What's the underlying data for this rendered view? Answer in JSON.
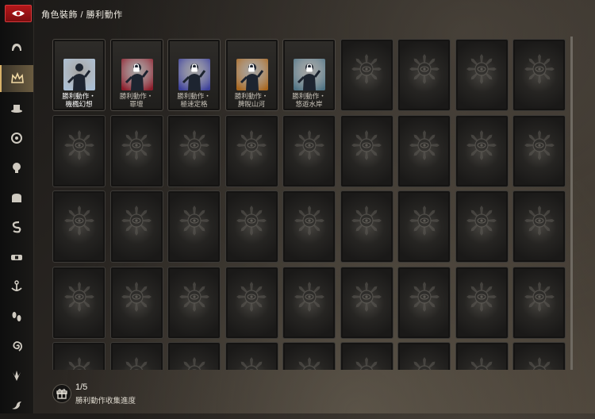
{
  "breadcrumb": "角色裝飾 / 勝利動作",
  "sidebar": {
    "back_icon": "eye-back-icon",
    "items": [
      {
        "icon": "hair-icon",
        "active": false
      },
      {
        "icon": "crown-icon",
        "active": true
      },
      {
        "icon": "hat-icon",
        "active": false
      },
      {
        "icon": "face-accessory-icon",
        "active": false
      },
      {
        "icon": "head-icon",
        "active": false
      },
      {
        "icon": "body-icon",
        "active": false
      },
      {
        "icon": "snake-icon",
        "active": false
      },
      {
        "icon": "belt-icon",
        "active": false
      },
      {
        "icon": "anchor-icon",
        "active": false
      },
      {
        "icon": "footprint-icon",
        "active": false
      },
      {
        "icon": "spiral-icon",
        "active": false
      },
      {
        "icon": "wings-icon",
        "active": false
      },
      {
        "icon": "dragon-icon",
        "active": false
      }
    ]
  },
  "items": [
    {
      "line1": "勝利動作・",
      "line2": "機楓幻想",
      "locked": false,
      "theme": "#a9bfd6"
    },
    {
      "line1": "勝利動作・",
      "line2": "罪壇",
      "locked": true,
      "theme": "#8c1c2a"
    },
    {
      "line1": "勝利動作・",
      "line2": "極速定格",
      "locked": true,
      "theme": "#3b3f9a"
    },
    {
      "line1": "勝利動作・",
      "line2": "脾睨山河",
      "locked": true,
      "theme": "#a8661e"
    },
    {
      "line1": "勝利動作・",
      "line2": "悠遊水岸",
      "locked": true,
      "theme": "#4f7384"
    }
  ],
  "grid": {
    "columns": 9,
    "visible_rows": 5
  },
  "progress": {
    "count": "1/5",
    "label": "勝利動作收集進度",
    "icon": "gift-icon"
  }
}
